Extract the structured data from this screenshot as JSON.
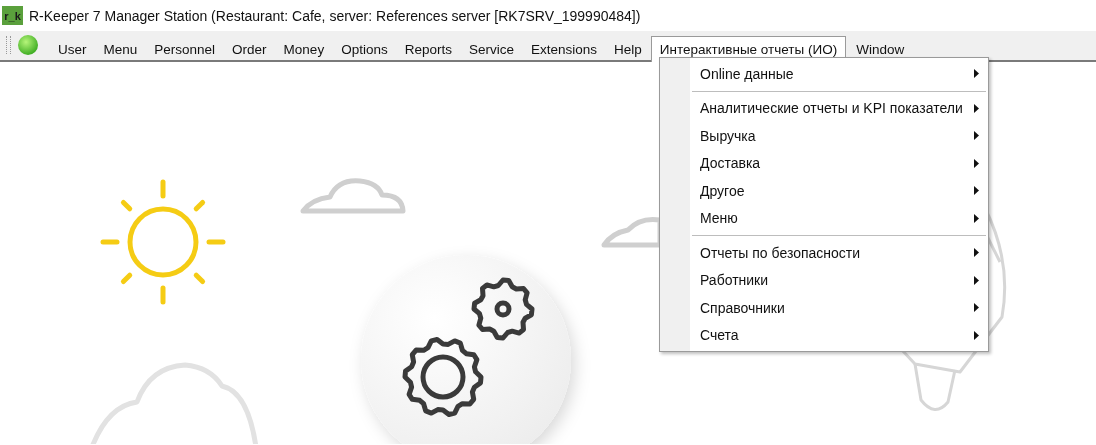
{
  "window": {
    "icon_text": "r_k",
    "title": "R-Keeper 7 Manager Station (Restaurant: Cafe, server: References server [RK7SRV_199990484])"
  },
  "menu_bar": [
    {
      "label": "User",
      "selected": false
    },
    {
      "label": "Menu",
      "selected": false
    },
    {
      "label": "Personnel",
      "selected": false
    },
    {
      "label": "Order",
      "selected": false
    },
    {
      "label": "Money",
      "selected": false
    },
    {
      "label": "Options",
      "selected": false
    },
    {
      "label": "Reports",
      "selected": false
    },
    {
      "label": "Service",
      "selected": false
    },
    {
      "label": "Extensions",
      "selected": false
    },
    {
      "label": "Help",
      "selected": false
    },
    {
      "label": "Интерактивные отчеты (ИО)",
      "selected": true
    },
    {
      "label": "Window",
      "selected": false
    }
  ],
  "dropdown": {
    "sections": [
      {
        "items": [
          {
            "label": "Online данные",
            "submenu": true
          }
        ]
      },
      {
        "items": [
          {
            "label": "Аналитические отчеты и KPI показатели",
            "submenu": true
          },
          {
            "label": "Выручка",
            "submenu": true
          },
          {
            "label": "Доставка",
            "submenu": true
          },
          {
            "label": "Другое",
            "submenu": true
          },
          {
            "label": "Меню",
            "submenu": true
          }
        ]
      },
      {
        "items": [
          {
            "label": "Отчеты по безопасности",
            "submenu": true
          },
          {
            "label": "Работники",
            "submenu": true
          },
          {
            "label": "Справочники",
            "submenu": true
          },
          {
            "label": "Счета",
            "submenu": true
          }
        ]
      }
    ]
  }
}
